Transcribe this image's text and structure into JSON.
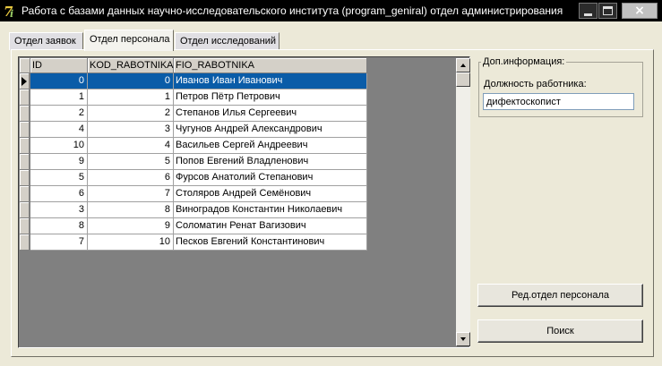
{
  "window": {
    "title": "Работа с базами данных научно-исследовательского института (program_geniral) отдел администрирования",
    "close_label": "×"
  },
  "tabs": [
    {
      "label": "Отдел заявок"
    },
    {
      "label": "Отдел персонала"
    },
    {
      "label": "Отдел исследований"
    }
  ],
  "grid": {
    "columns": [
      "ID",
      "KOD_RABOTNIKA",
      "FIO_RABOTNIKA"
    ],
    "rows": [
      {
        "id": "0",
        "kod": "0",
        "fio": "Иванов Иван Иванович"
      },
      {
        "id": "1",
        "kod": "1",
        "fio": "Петров Пётр Петрович"
      },
      {
        "id": "2",
        "kod": "2",
        "fio": "Степанов Илья Сергеевич"
      },
      {
        "id": "4",
        "kod": "3",
        "fio": "Чугунов Андрей Александрович"
      },
      {
        "id": "10",
        "kod": "4",
        "fio": "Васильев Сергей Андреевич"
      },
      {
        "id": "9",
        "kod": "5",
        "fio": "Попов Евгений Владленович"
      },
      {
        "id": "5",
        "kod": "6",
        "fio": "Фурсов Анатолий Степанович"
      },
      {
        "id": "6",
        "kod": "7",
        "fio": "Столяров Андрей Семёнович"
      },
      {
        "id": "3",
        "kod": "8",
        "fio": "Виноградов Константин Николаевич"
      },
      {
        "id": "8",
        "kod": "9",
        "fio": "Соломатин Ренат Вагизович"
      },
      {
        "id": "7",
        "kod": "10",
        "fio": "Песков Евгений Константинович"
      }
    ]
  },
  "info": {
    "group_title": "Доп.информация:",
    "position_label": "Должность работника:",
    "position_value": "дифектоскопист"
  },
  "buttons": {
    "edit": "Ред.отдел персонала",
    "search": "Поиск"
  },
  "colors": {
    "selection": "#0a5ca8",
    "window_bg": "#ece9d8"
  }
}
